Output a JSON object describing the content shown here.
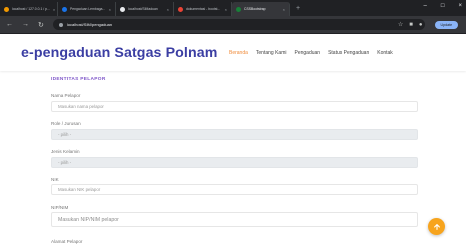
{
  "browser": {
    "tabs": [
      {
        "title": "localhost / 127.0.0.1 / p...",
        "color": "#f29900"
      },
      {
        "title": "Pengaduan Lembaga...",
        "color": "#1a73e8"
      },
      {
        "title": "localhost/SIMaduan",
        "color": "#e8eaed"
      },
      {
        "title": "dokumentasi - bootst...",
        "color": "#ea4335"
      },
      {
        "title": "CSSBootstrap",
        "color": "#188038"
      }
    ],
    "active_tab_index": 4,
    "url": "localhost/SIM/pengaduan",
    "update_label": "Update"
  },
  "header": {
    "logo": "e-pengaduan Satgas Polnam",
    "nav": [
      "Beranda",
      "Tentang Kami",
      "Pengaduan",
      "Status Pengaduan",
      "Kontak"
    ],
    "nav_active_index": 0
  },
  "form": {
    "section_title": "IDENTITAS PELAPOR",
    "fields": [
      {
        "label": "Nama Pelapor",
        "placeholder": "Masukan nama pelapor"
      },
      {
        "label": "Role / Jurusan",
        "placeholder": "- pilih -"
      },
      {
        "label": "Jenis Kelamin",
        "placeholder": "- pilih -"
      },
      {
        "label": "NIK",
        "placeholder": "Masukan NIK pelapor"
      },
      {
        "label": "NIP/NIM",
        "placeholder": "Masukan NIP/NIM pelapor"
      },
      {
        "label": "Alamat Pelapor",
        "placeholder": ""
      }
    ]
  },
  "colors": {
    "accent": "#3b3ea3",
    "nav_active": "#f08b3a",
    "fab": "#f7a41d",
    "section": "#7f57c9"
  }
}
